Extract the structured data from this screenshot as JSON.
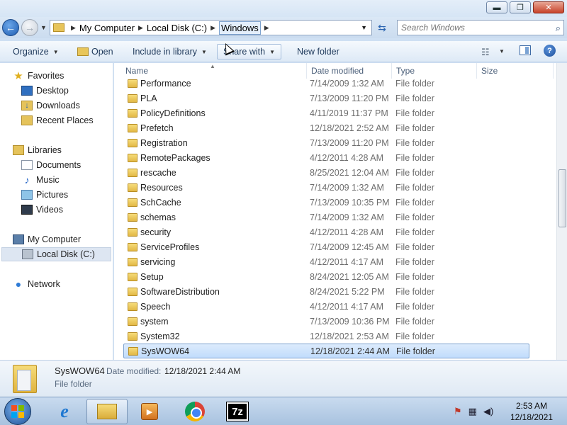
{
  "window": {
    "minimize": "▬",
    "maximize": "❐",
    "close": "✕"
  },
  "address": {
    "crumbs": [
      "My Computer",
      "Local Disk (C:)",
      "Windows"
    ],
    "search_placeholder": "Search Windows"
  },
  "toolbar": {
    "organize": "Organize",
    "open": "Open",
    "include": "Include in library",
    "share": "Share with",
    "new_folder": "New folder"
  },
  "nav": {
    "favorites": "Favorites",
    "desktop": "Desktop",
    "downloads": "Downloads",
    "recent": "Recent Places",
    "libraries": "Libraries",
    "documents": "Documents",
    "music": "Music",
    "pictures": "Pictures",
    "videos": "Videos",
    "computer": "My Computer",
    "local_disk": "Local Disk (C:)",
    "network": "Network"
  },
  "columns": {
    "name": "Name",
    "date": "Date modified",
    "type": "Type",
    "size": "Size"
  },
  "files": [
    {
      "name": "Performance",
      "date": "7/14/2009 1:32 AM",
      "type": "File folder"
    },
    {
      "name": "PLA",
      "date": "7/13/2009 11:20 PM",
      "type": "File folder"
    },
    {
      "name": "PolicyDefinitions",
      "date": "4/11/2019 11:37 PM",
      "type": "File folder"
    },
    {
      "name": "Prefetch",
      "date": "12/18/2021 2:52 AM",
      "type": "File folder"
    },
    {
      "name": "Registration",
      "date": "7/13/2009 11:20 PM",
      "type": "File folder"
    },
    {
      "name": "RemotePackages",
      "date": "4/12/2011 4:28 AM",
      "type": "File folder"
    },
    {
      "name": "rescache",
      "date": "8/25/2021 12:04 AM",
      "type": "File folder"
    },
    {
      "name": "Resources",
      "date": "7/14/2009 1:32 AM",
      "type": "File folder"
    },
    {
      "name": "SchCache",
      "date": "7/13/2009 10:35 PM",
      "type": "File folder"
    },
    {
      "name": "schemas",
      "date": "7/14/2009 1:32 AM",
      "type": "File folder"
    },
    {
      "name": "security",
      "date": "4/12/2011 4:28 AM",
      "type": "File folder"
    },
    {
      "name": "ServiceProfiles",
      "date": "7/14/2009 12:45 AM",
      "type": "File folder"
    },
    {
      "name": "servicing",
      "date": "4/12/2011 4:17 AM",
      "type": "File folder"
    },
    {
      "name": "Setup",
      "date": "8/24/2021 12:05 AM",
      "type": "File folder"
    },
    {
      "name": "SoftwareDistribution",
      "date": "8/24/2021 5:22 PM",
      "type": "File folder"
    },
    {
      "name": "Speech",
      "date": "4/12/2011 4:17 AM",
      "type": "File folder"
    },
    {
      "name": "system",
      "date": "7/13/2009 10:36 PM",
      "type": "File folder"
    },
    {
      "name": "System32",
      "date": "12/18/2021 2:53 AM",
      "type": "File folder"
    },
    {
      "name": "SysWOW64",
      "date": "12/18/2021 2:44 AM",
      "type": "File folder",
      "selected": true
    }
  ],
  "details": {
    "name": "SysWOW64",
    "date_label": "Date modified:",
    "date_value": "12/18/2021 2:44 AM",
    "type": "File folder"
  },
  "taskbar": {
    "sevenzip": "7z",
    "time": "2:53 AM",
    "date": "12/18/2021"
  },
  "colors": {
    "selection": "#c9e0fc",
    "selection_border": "#7da2ce",
    "chrome": "#cfe0f3"
  }
}
